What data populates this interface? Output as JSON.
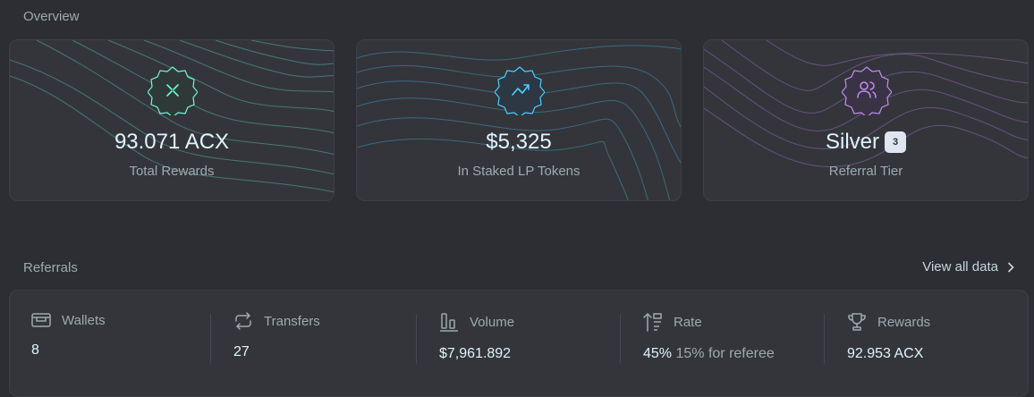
{
  "overview": {
    "title": "Overview",
    "cards": [
      {
        "value": "93.071 ACX",
        "label": "Total Rewards",
        "icon": "rewards-cross-icon",
        "accent": "#6cf9d8"
      },
      {
        "value": "$5,325",
        "label": "In Staked LP Tokens",
        "icon": "trend-up-icon",
        "accent": "#44d2ff"
      },
      {
        "value": "Silver",
        "tier": "3",
        "label": "Referral Tier",
        "icon": "users-icon",
        "accent": "#c08df5"
      }
    ]
  },
  "referrals": {
    "title": "Referrals",
    "view_all": "View all data",
    "stats": [
      {
        "label": "Wallets",
        "value": "8",
        "icon": "wallet-icon"
      },
      {
        "label": "Transfers",
        "value": "27",
        "icon": "repeat-icon"
      },
      {
        "label": "Volume",
        "value": "$7,961.892",
        "icon": "bar-chart-icon"
      },
      {
        "label": "Rate",
        "value": "45%",
        "sub": "15% for referee",
        "icon": "sort-rate-icon"
      },
      {
        "label": "Rewards",
        "value": "92.953 ACX",
        "icon": "trophy-icon"
      }
    ]
  }
}
